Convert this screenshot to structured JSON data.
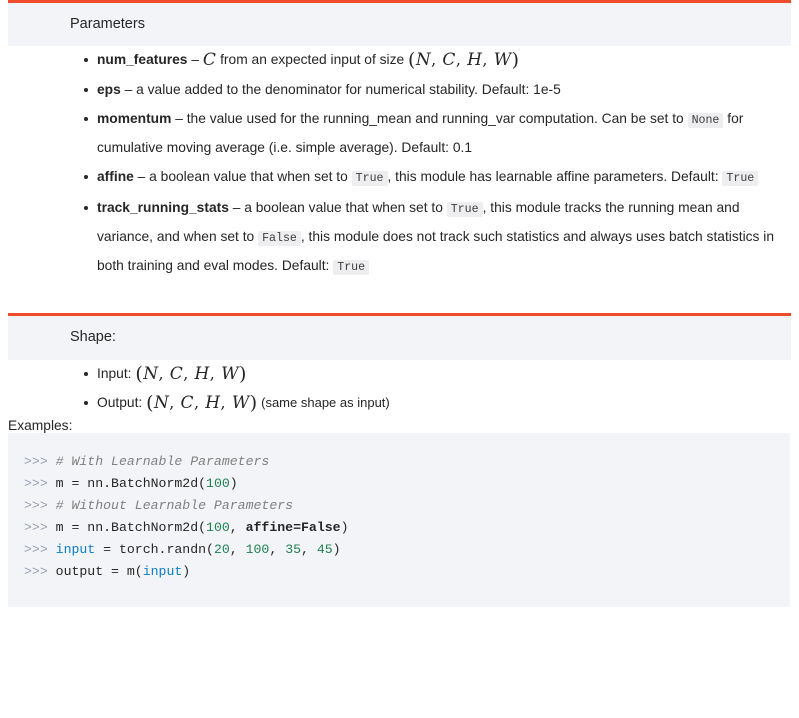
{
  "theme": {
    "accent": "#ee4c2c",
    "block_bg": "#f3f4f7",
    "text": "#262626",
    "inline_code_bg": "#eeeef1",
    "code_number": "#208050",
    "code_name": "#0b7ec9",
    "code_comment": "#808080",
    "code_prompt": "#9ba0b0"
  },
  "parameters_section": {
    "title": "Parameters",
    "items": [
      {
        "name": "num_features",
        "dash": "–",
        "parts": [
          {
            "type": "math",
            "text": "C"
          },
          {
            "type": "text",
            "text": " from an expected input of size "
          },
          {
            "type": "math",
            "text": "(N, C, H, W)"
          }
        ]
      },
      {
        "name": "eps",
        "dash": "–",
        "parts": [
          {
            "type": "text",
            "text": " a value added to the denominator for numerical stability. Default: 1e-5"
          }
        ]
      },
      {
        "name": "momentum",
        "dash": "–",
        "parts": [
          {
            "type": "text",
            "text": " the value used for the running_mean and running_var computation. Can be set to "
          },
          {
            "type": "code",
            "text": "None"
          },
          {
            "type": "text",
            "text": " for cumulative moving average (i.e. simple average). Default: 0.1"
          }
        ]
      },
      {
        "name": "affine",
        "dash": "–",
        "parts": [
          {
            "type": "text",
            "text": " a boolean value that when set to "
          },
          {
            "type": "code",
            "text": "True"
          },
          {
            "type": "text",
            "text": ", this module has learnable affine parameters. Default: "
          },
          {
            "type": "code",
            "text": "True"
          }
        ]
      },
      {
        "name": "track_running_stats",
        "dash": "–",
        "parts": [
          {
            "type": "text",
            "text": " a boolean value that when set to "
          },
          {
            "type": "code",
            "text": "True"
          },
          {
            "type": "text",
            "text": ", this module tracks the running mean and variance, and when set to "
          },
          {
            "type": "code",
            "text": "False"
          },
          {
            "type": "text",
            "text": ", this module does not track such statistics and always uses batch statistics in both training and eval modes. Default: "
          },
          {
            "type": "code",
            "text": "True"
          }
        ]
      }
    ]
  },
  "shape_section": {
    "title": "Shape:",
    "items": [
      {
        "label": "Input:",
        "math": "(N, C, H, W)",
        "suffix": ""
      },
      {
        "label": "Output:",
        "math": "(N, C, H, W)",
        "suffix": "(same shape as input)"
      }
    ]
  },
  "examples_section": {
    "label": "Examples:",
    "code_lines": [
      {
        "tokens": [
          {
            "t": "prompt",
            "s": ">>> "
          },
          {
            "t": "comment",
            "s": "# With Learnable Parameters"
          }
        ]
      },
      {
        "tokens": [
          {
            "t": "prompt",
            "s": ">>> "
          },
          {
            "t": "plain",
            "s": "m = nn.BatchNorm2d("
          },
          {
            "t": "num",
            "s": "100"
          },
          {
            "t": "punct",
            "s": ")"
          }
        ]
      },
      {
        "tokens": [
          {
            "t": "prompt",
            "s": ">>> "
          },
          {
            "t": "comment",
            "s": "# Without Learnable Parameters"
          }
        ]
      },
      {
        "tokens": [
          {
            "t": "prompt",
            "s": ">>> "
          },
          {
            "t": "plain",
            "s": "m = nn.BatchNorm2d("
          },
          {
            "t": "num",
            "s": "100"
          },
          {
            "t": "punct",
            "s": ", "
          },
          {
            "t": "bold",
            "s": "affine=False"
          },
          {
            "t": "punct",
            "s": ")"
          }
        ]
      },
      {
        "tokens": [
          {
            "t": "prompt",
            "s": ">>> "
          },
          {
            "t": "name",
            "s": "input"
          },
          {
            "t": "plain",
            "s": " = torch.randn("
          },
          {
            "t": "num",
            "s": "20"
          },
          {
            "t": "punct",
            "s": ", "
          },
          {
            "t": "num",
            "s": "100"
          },
          {
            "t": "punct",
            "s": ", "
          },
          {
            "t": "num",
            "s": "35"
          },
          {
            "t": "punct",
            "s": ", "
          },
          {
            "t": "num",
            "s": "45"
          },
          {
            "t": "punct",
            "s": ")"
          }
        ]
      },
      {
        "tokens": [
          {
            "t": "prompt",
            "s": ">>> "
          },
          {
            "t": "plain",
            "s": "output = m("
          },
          {
            "t": "name",
            "s": "input"
          },
          {
            "t": "punct",
            "s": ")"
          }
        ]
      }
    ]
  }
}
